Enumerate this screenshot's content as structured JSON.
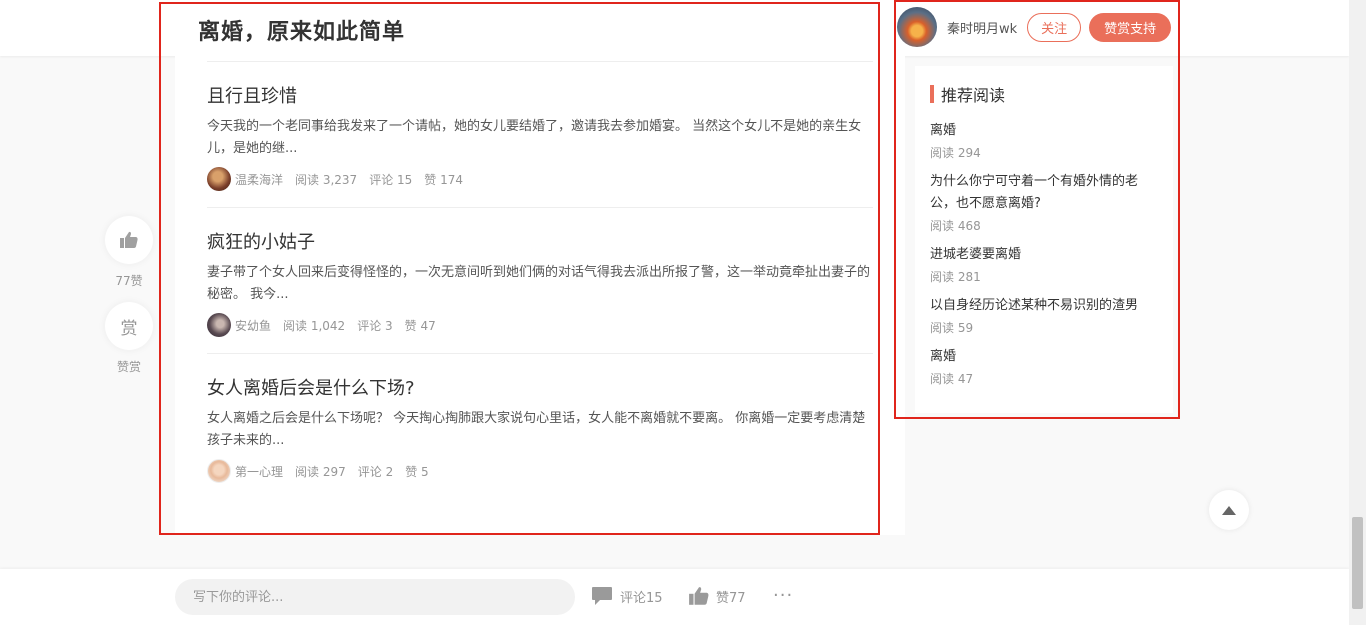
{
  "page": {
    "title": "离婚，原来如此简单"
  },
  "author": {
    "name": "秦时明月wk",
    "follow_label": "关注",
    "tip_label": "赞赏支持"
  },
  "articles": [
    {
      "title": "且行且珍惜",
      "abstract": "今天我的一个老同事给我发来了一个请帖，她的女儿要结婚了，邀请我去参加婚宴。 当然这个女儿不是她的亲生女儿，是她的继...",
      "author": "温柔海洋",
      "reads": "阅读 3,237",
      "comments": "评论 15",
      "likes": "赞 174"
    },
    {
      "title": "疯狂的小姑子",
      "abstract": "妻子带了个女人回来后变得怪怪的，一次无意间听到她们俩的对话气得我去派出所报了警，这一举动竟牵扯出妻子的秘密。 我今...",
      "author": "安幼鱼",
      "reads": "阅读 1,042",
      "comments": "评论 3",
      "likes": "赞 47"
    },
    {
      "title": "女人离婚后会是什么下场?",
      "abstract": "女人离婚之后会是什么下场呢？ 今天掏心掏肺跟大家说句心里话，女人能不离婚就不要离。 你离婚一定要考虑清楚孩子未来的...",
      "author": "第一心理",
      "reads": "阅读 297",
      "comments": "评论 2",
      "likes": "赞 5"
    }
  ],
  "side_actions": {
    "like_label": "77赞",
    "tip_label": "赞赏",
    "tip_glyph": "赏"
  },
  "recommend": {
    "title": "推荐阅读",
    "items": [
      {
        "title": "离婚",
        "reads": "阅读 294"
      },
      {
        "title": "为什么你宁可守着一个有婚外情的老公，也不愿意离婚?",
        "reads": "阅读 468"
      },
      {
        "title": "进城老婆要离婚",
        "reads": "阅读 281"
      },
      {
        "title": "以自身经历论述某种不易识别的渣男",
        "reads": "阅读 59"
      },
      {
        "title": "离婚",
        "reads": "阅读 47"
      }
    ]
  },
  "bottom": {
    "placeholder": "写下你的评论...",
    "comments_label": "评论15",
    "likes_label": "赞77",
    "more": "···"
  },
  "colors": {
    "accent": "#ea6f5a",
    "highlight": "#e0251c"
  }
}
